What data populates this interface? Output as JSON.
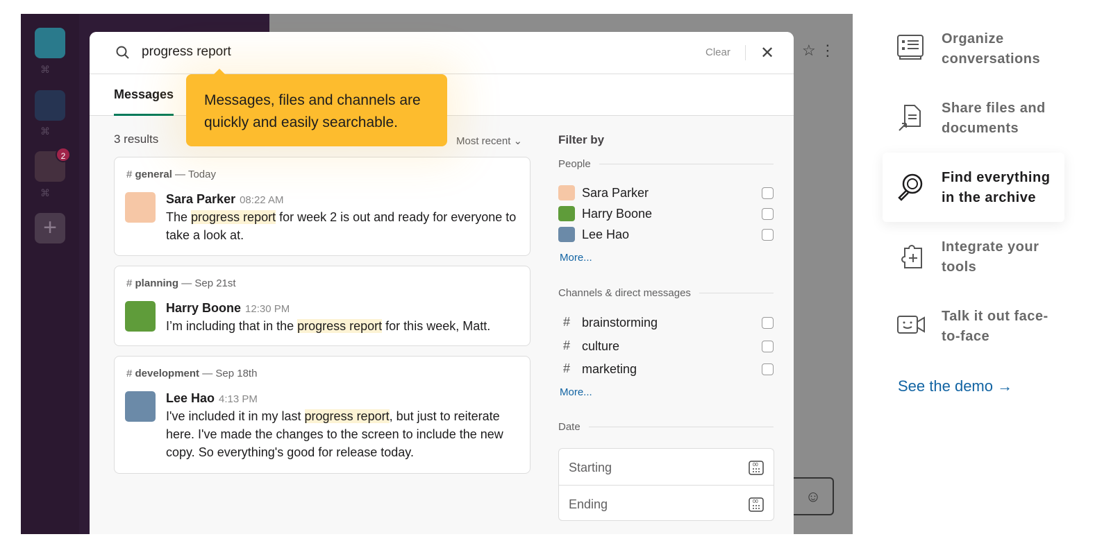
{
  "app": {
    "badge": "2",
    "cmd": "⌘"
  },
  "search": {
    "query": "progress report",
    "clear": "Clear"
  },
  "tabs": [
    {
      "label": "Messages"
    }
  ],
  "tooltip": "Messages, files and channels are quickly and easily searchable.",
  "results": {
    "count": "3 results",
    "sort": "Most recent",
    "items": [
      {
        "channel": "general",
        "date": "— Today",
        "name": "Sara Parker",
        "time": "08:22 AM",
        "pre": "The ",
        "hl": "progress report",
        "post": " for week 2 is out and ready for everyone to take a look at.",
        "avatar_color": "#f6c7a6"
      },
      {
        "channel": "planning",
        "date": "— Sep 21st",
        "name": "Harry Boone",
        "time": "12:30 PM",
        "pre": "I’m including that in the ",
        "hl": "progress report",
        "post": " for this week, Matt.",
        "avatar_color": "#5f9c3a"
      },
      {
        "channel": "development",
        "date": "— Sep 18th",
        "name": "Lee Hao",
        "time": "4:13 PM",
        "pre": "I've included it in my last ",
        "hl": "progress report",
        "post": ", but just to reiterate here. I've made the changes to the screen to include the new copy. So everything's good for release today.",
        "avatar_color": "#6b8aa8"
      }
    ]
  },
  "filter": {
    "title": "Filter by",
    "people_label": "People",
    "people": [
      "Sara Parker",
      "Harry Boone",
      "Lee Hao"
    ],
    "more": "More...",
    "channels_label": "Channels & direct messages",
    "channels": [
      "brainstorming",
      "culture",
      "marketing"
    ],
    "date_label": "Date",
    "starting": "Starting",
    "ending": "Ending"
  },
  "features": [
    {
      "label": "Organize conversations",
      "icon": "list-icon"
    },
    {
      "label": "Share files and documents",
      "icon": "file-share-icon"
    },
    {
      "label": "Find everything in the archive",
      "icon": "search-archive-icon",
      "active": true
    },
    {
      "label": "Integrate your tools",
      "icon": "puzzle-plus-icon"
    },
    {
      "label": "Talk it out face-to-face",
      "icon": "video-icon"
    }
  ],
  "demo": "See the demo →",
  "colors": {
    "accent": "#007a5a",
    "tooltip": "#fdbc2e",
    "link": "#1264a3",
    "sidebar": "#2b1830"
  }
}
